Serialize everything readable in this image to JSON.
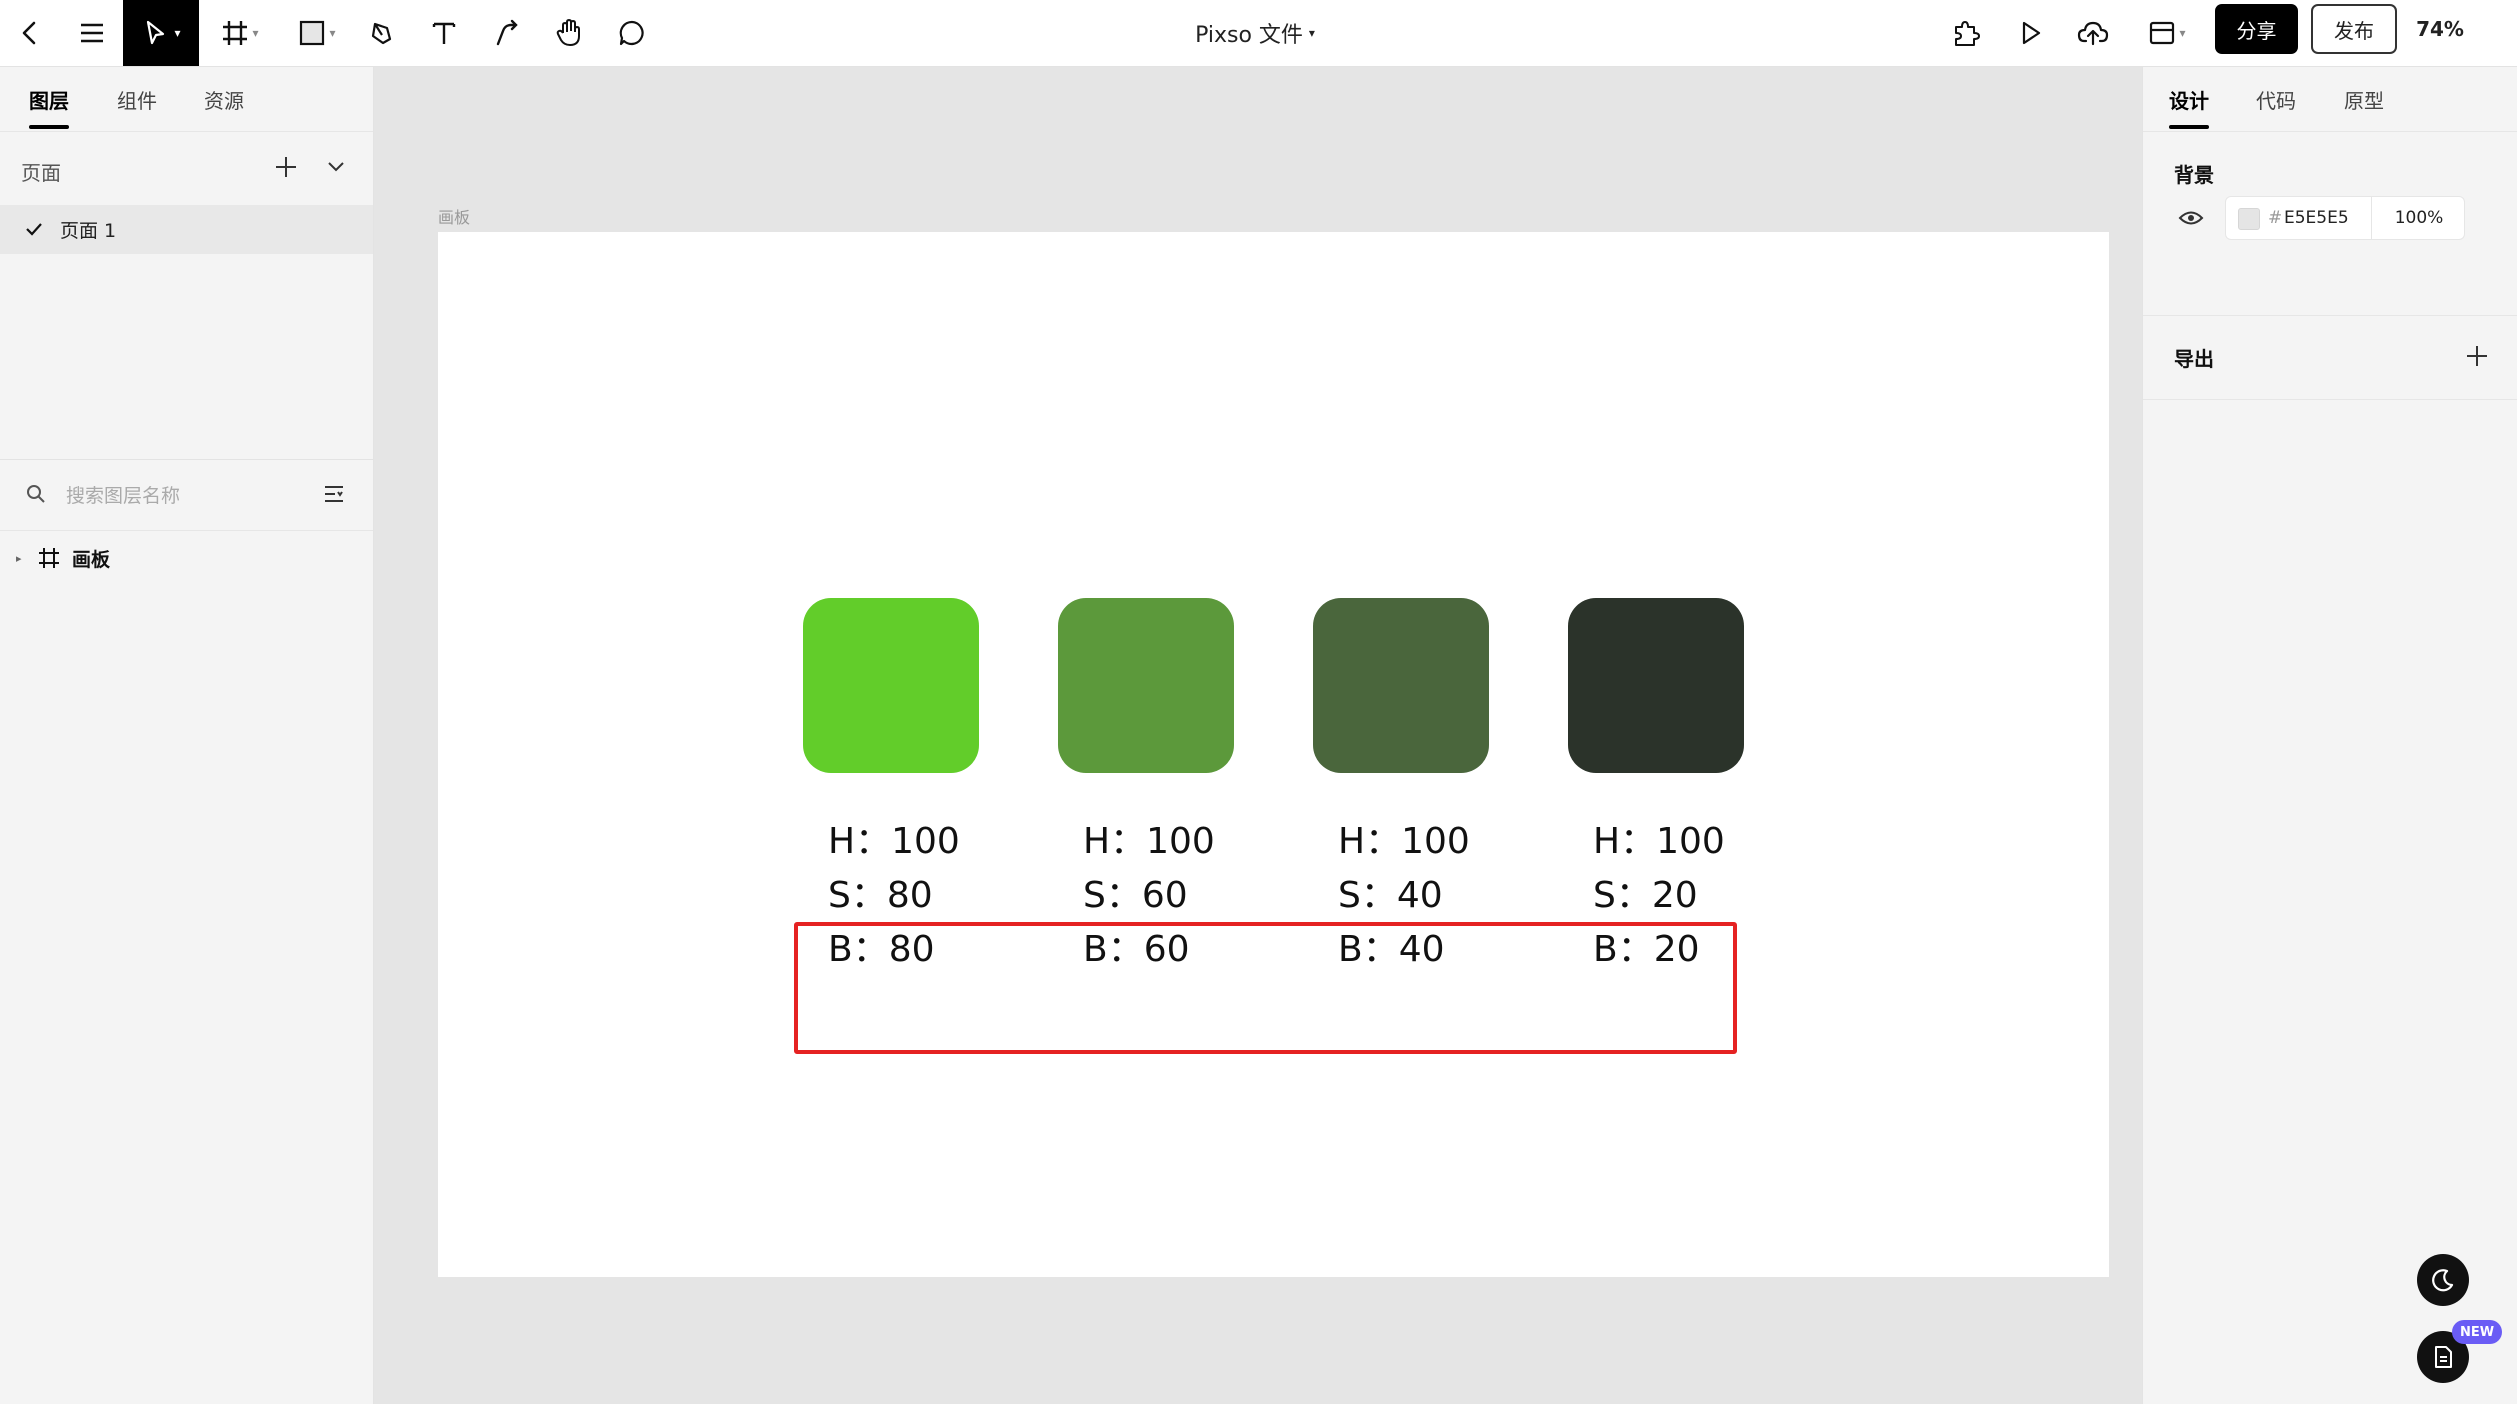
{
  "toolbar": {
    "doc_title": "Pixso 文件",
    "share_label": "分享",
    "publish_label": "发布",
    "zoom": "74%"
  },
  "left_panel": {
    "tabs": [
      "图层",
      "组件",
      "资源"
    ],
    "pages_title": "页面",
    "pages": [
      "页面 1"
    ],
    "search_placeholder": "搜索图层名称",
    "layers": [
      "画板"
    ]
  },
  "canvas": {
    "frame_label": "画板",
    "background": "#ffffff",
    "highlight_color": "#e52222",
    "swatches": [
      {
        "color": "#62cd2a",
        "h": "H：100",
        "s": "S：80",
        "b": "B：80"
      },
      {
        "color": "#5c993b",
        "h": "H：100",
        "s": "S：60",
        "b": "B：60"
      },
      {
        "color": "#4a663c",
        "h": "H：100",
        "s": "S：40",
        "b": "B：40"
      },
      {
        "color": "#2b332a",
        "h": "H：100",
        "s": "S：20",
        "b": "B：20"
      }
    ]
  },
  "right_panel": {
    "tabs": [
      "设计",
      "代码",
      "原型"
    ],
    "background_title": "背景",
    "bg_hash": "#",
    "bg_hex": "E5E5E5",
    "bg_opacity": "100%",
    "bg_color": "#e5e5e5",
    "export_title": "导出"
  },
  "badge": {
    "new_label": "NEW"
  },
  "colors": {
    "accent": "#000000",
    "badge": "#6a5cf5"
  }
}
